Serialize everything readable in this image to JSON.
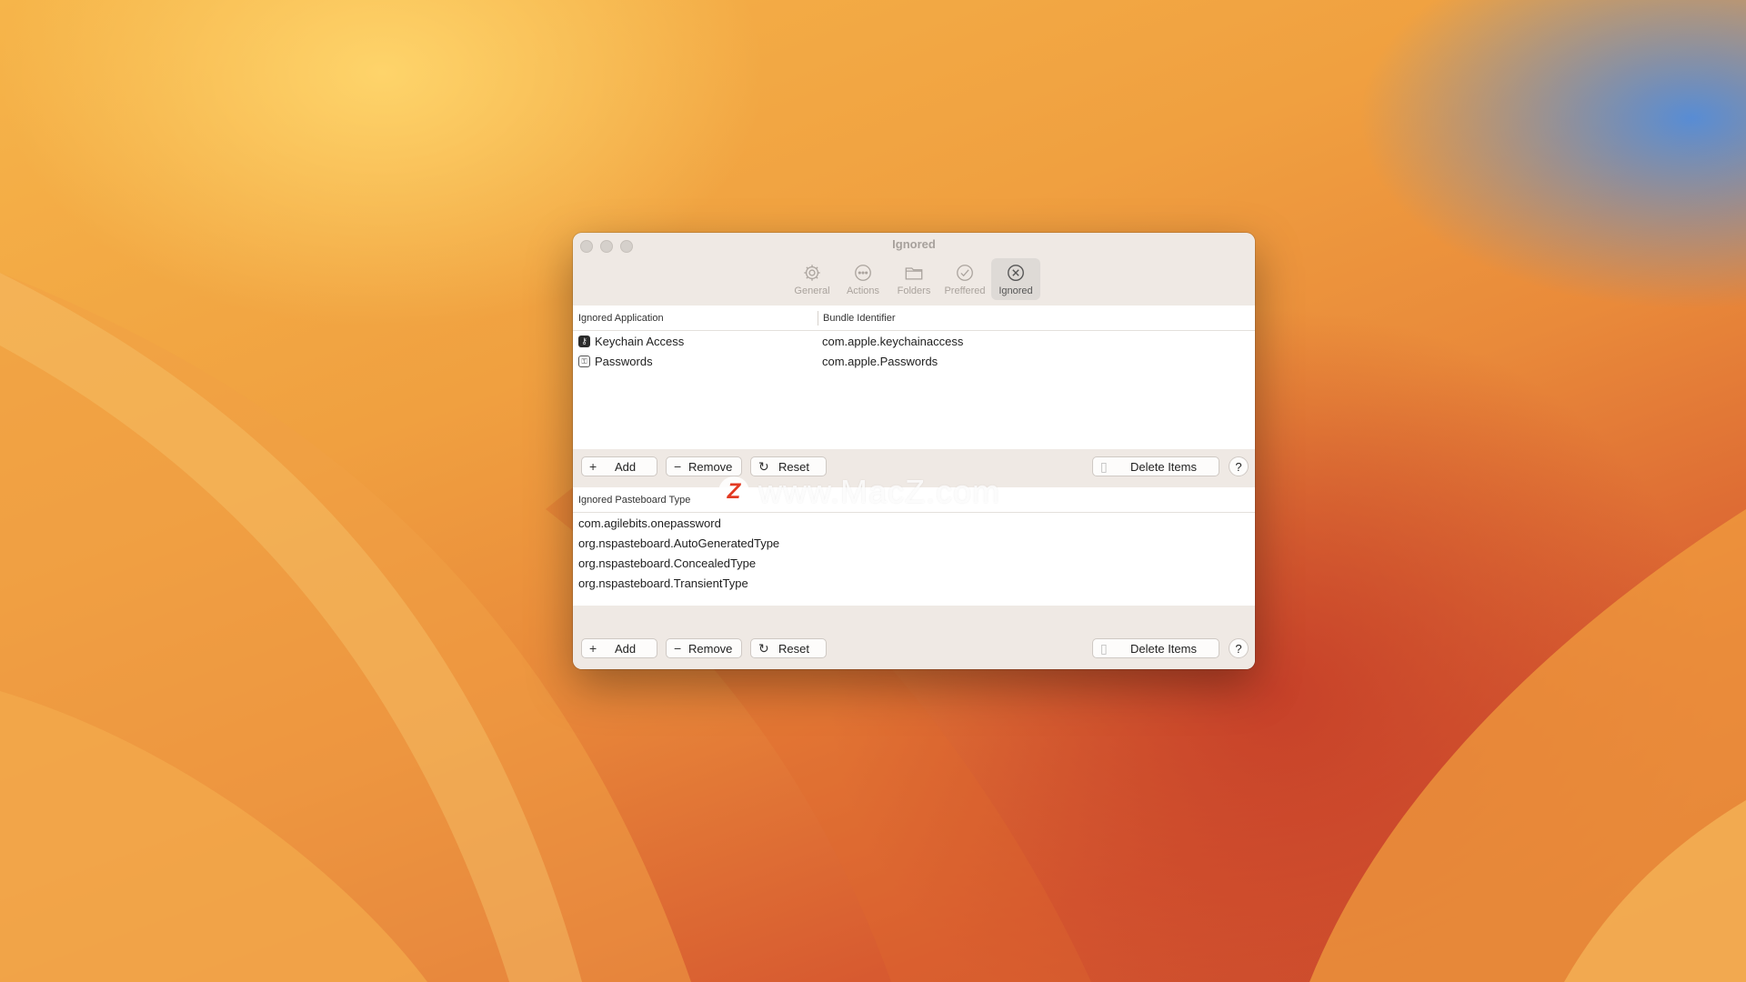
{
  "window": {
    "title": "Ignored",
    "toolbar": [
      {
        "label": "General",
        "icon": "gear-icon",
        "active": false
      },
      {
        "label": "Actions",
        "icon": "ellipsis-circle-icon",
        "active": false
      },
      {
        "label": "Folders",
        "icon": "folder-icon",
        "active": false
      },
      {
        "label": "Preffered",
        "icon": "checkmark-circle-icon",
        "active": false
      },
      {
        "label": "Ignored",
        "icon": "xmark-circle-icon",
        "active": true
      }
    ]
  },
  "apps_table": {
    "headers": [
      "Ignored Application",
      "Bundle Identifier"
    ],
    "rows": [
      {
        "name": "Keychain Access",
        "bundle": "com.apple.keychainaccess",
        "icon": "keychain-icon"
      },
      {
        "name": "Passwords",
        "bundle": "com.apple.Passwords",
        "icon": "passwords-icon"
      }
    ]
  },
  "pasteboard_table": {
    "header": "Ignored Pasteboard Type",
    "rows": [
      "com.agilebits.onepassword",
      "org.nspasteboard.AutoGeneratedType",
      "org.nspasteboard.ConcealedType",
      "org.nspasteboard.TransientType"
    ]
  },
  "buttons": {
    "add": "Add",
    "remove": "Remove",
    "reset": "Reset",
    "delete_items": "Delete Items",
    "help": "?"
  },
  "watermark": {
    "logo": "Z",
    "text": "www.MacZ.com"
  }
}
